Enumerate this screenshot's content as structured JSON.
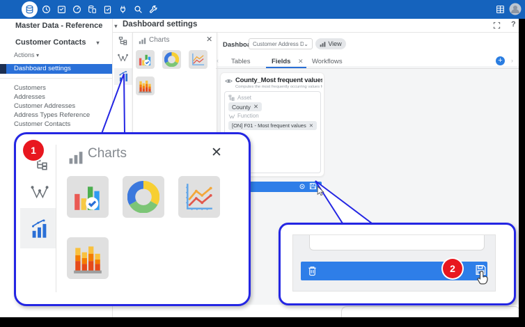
{
  "toolbar": {
    "left_icons": [
      "database",
      "clock",
      "calendar-check",
      "gauge",
      "database-doc",
      "clipboard-check",
      "plug",
      "search",
      "wrench"
    ],
    "right_icons": [
      "table-grid",
      "user-avatar"
    ]
  },
  "sidebar": {
    "domain_selector": "Master Data - Reference",
    "entity_selector": "Customer Contacts",
    "actions_label": "Actions",
    "selected_item": "Dashboard settings",
    "items": [
      "Customers",
      "Addresses",
      "Customer Addresses",
      "Address Types Reference",
      "Customer Contacts"
    ]
  },
  "header": {
    "title": "Dashboard settings",
    "right_icons": [
      "expand",
      "help"
    ],
    "help_glyph": "?"
  },
  "charts_panel": {
    "title": "Charts",
    "nav_icons": [
      "hierarchy",
      "function",
      "chart"
    ],
    "tiles": [
      "bar-chart",
      "donut-chart",
      "line-chart",
      "stacked-bar-chart"
    ]
  },
  "dashboard_bar": {
    "label": "Dashboard",
    "selected_value": "Customer Address Datase",
    "view_button": "View"
  },
  "tabs": {
    "items": [
      "Tables",
      "Fields",
      "Workflows"
    ],
    "active": "Fields"
  },
  "field_card": {
    "title": "County_Most frequent values",
    "subtitle": "Computes the most frequently occurring values for a field.",
    "asset_label": "Asset",
    "asset_value": "County",
    "function_label": "Function",
    "function_value": "[ON] F01 - Most frequent values"
  },
  "action_bar": {
    "icons": [
      "gear",
      "save"
    ]
  },
  "callout1": {
    "badge": "1",
    "title": "Charts"
  },
  "callout2": {
    "badge": "2",
    "icons": [
      "trash",
      "save"
    ]
  },
  "colors": {
    "toolbar_blue": "#1563bd",
    "selection_blue": "#2a70d8",
    "action_bar_blue": "#2e7ee8",
    "callout_border_blue": "#2426e3",
    "badge_red": "#e8171f",
    "tab_underline_blue": "#2a6fd6"
  }
}
